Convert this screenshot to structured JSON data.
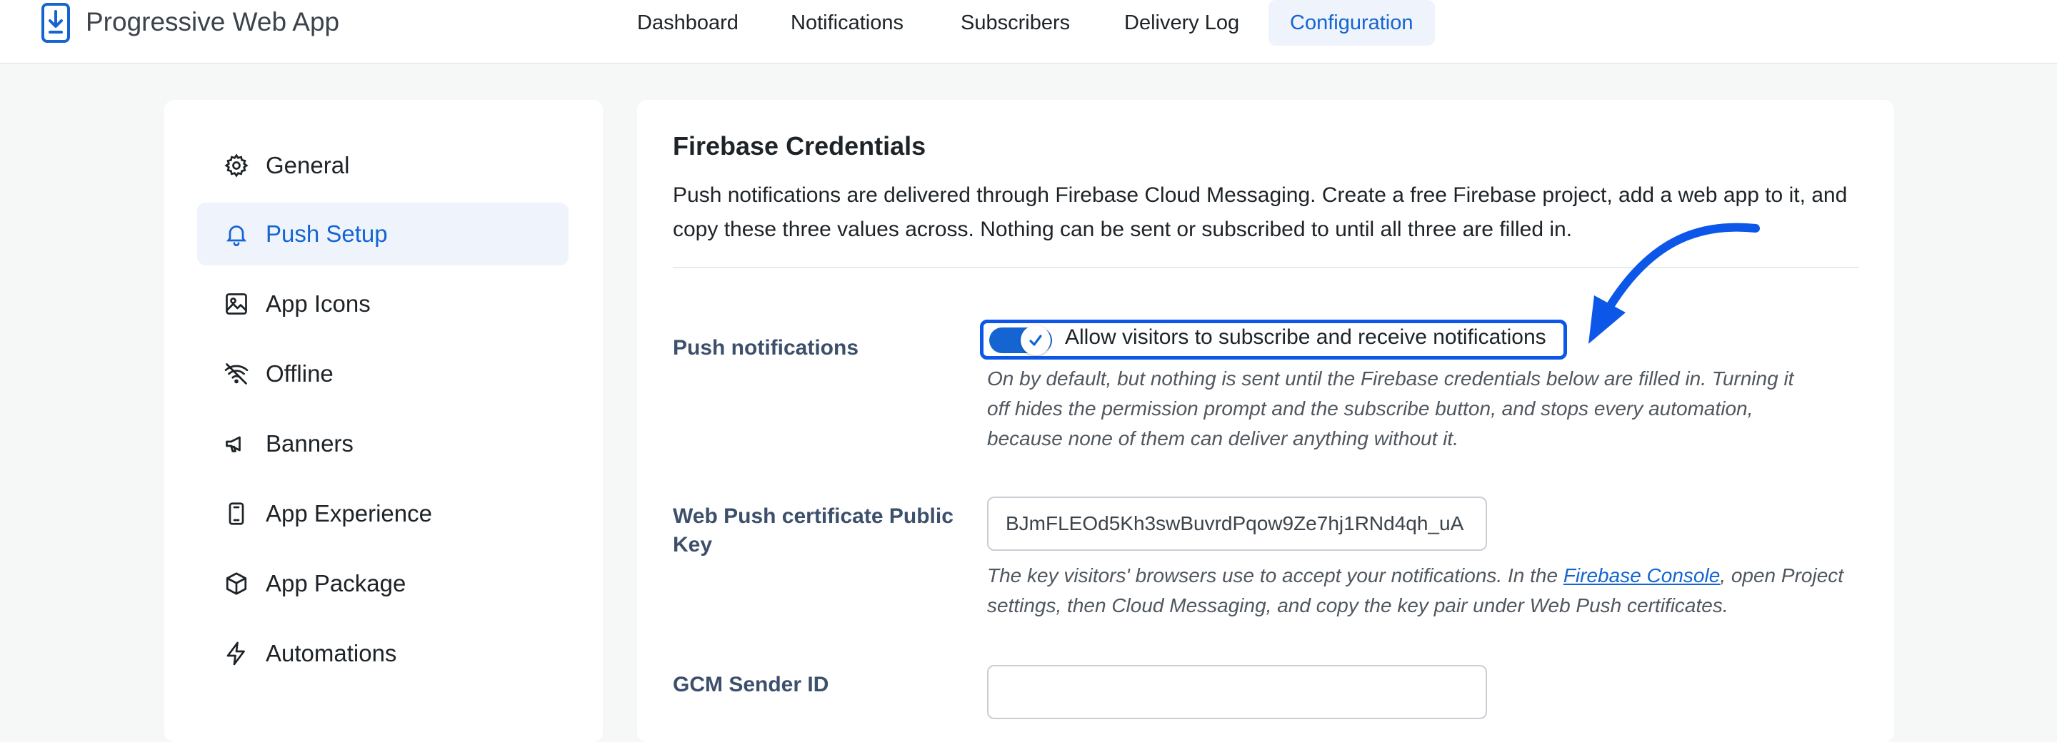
{
  "app": {
    "title": "Progressive Web App",
    "logo_icon": "download-phone-icon"
  },
  "nav": {
    "items": [
      {
        "label": "Dashboard",
        "active": false
      },
      {
        "label": "Notifications",
        "active": false
      },
      {
        "label": "Subscribers",
        "active": false
      },
      {
        "label": "Delivery Log",
        "active": false
      },
      {
        "label": "Configuration",
        "active": true
      }
    ]
  },
  "sidebar": {
    "items": [
      {
        "label": "General",
        "icon": "gear-icon",
        "active": false
      },
      {
        "label": "Push Setup",
        "icon": "bell-icon",
        "active": true
      },
      {
        "label": "App Icons",
        "icon": "image-icon",
        "active": false
      },
      {
        "label": "Offline",
        "icon": "wifi-off-icon",
        "active": false
      },
      {
        "label": "Banners",
        "icon": "megaphone-icon",
        "active": false
      },
      {
        "label": "App Experience",
        "icon": "phone-icon",
        "active": false
      },
      {
        "label": "App Package",
        "icon": "box-icon",
        "active": false
      },
      {
        "label": "Automations",
        "icon": "lightning-icon",
        "active": false
      }
    ]
  },
  "section": {
    "title": "Firebase Credentials",
    "description": "Push notifications are delivered through Firebase Cloud Messaging. Create a free Firebase project, add a web app to it, and copy these three values across. Nothing can be sent or subscribed to until all three are filled in."
  },
  "fields": {
    "push": {
      "label": "Push notifications",
      "toggle_label": "Allow visitors to subscribe and receive notifications",
      "toggle_on": true,
      "help": "On by default, but nothing is sent until the Firebase credentials below are filled in. Turning it off hides the permission prompt and the subscribe button, and stops every automation, because none of them can deliver anything without it."
    },
    "public_key": {
      "label": "Web Push certificate Public Key",
      "value": "BJmFLEOd5Kh3swBuvrdPqow9Ze7hj1RNd4qh_uA",
      "help_before": "The key visitors' browsers use to accept your notifications. In the ",
      "help_link": "Firebase Console",
      "help_after": ", open Project settings, then Cloud Messaging, and copy the key pair under Web Push certificates."
    },
    "sender_id": {
      "label": "GCM Sender ID"
    }
  },
  "colors": {
    "accent": "#1465d1",
    "highlight_outline": "#0d57e8",
    "active_bg": "#eef3fc"
  }
}
